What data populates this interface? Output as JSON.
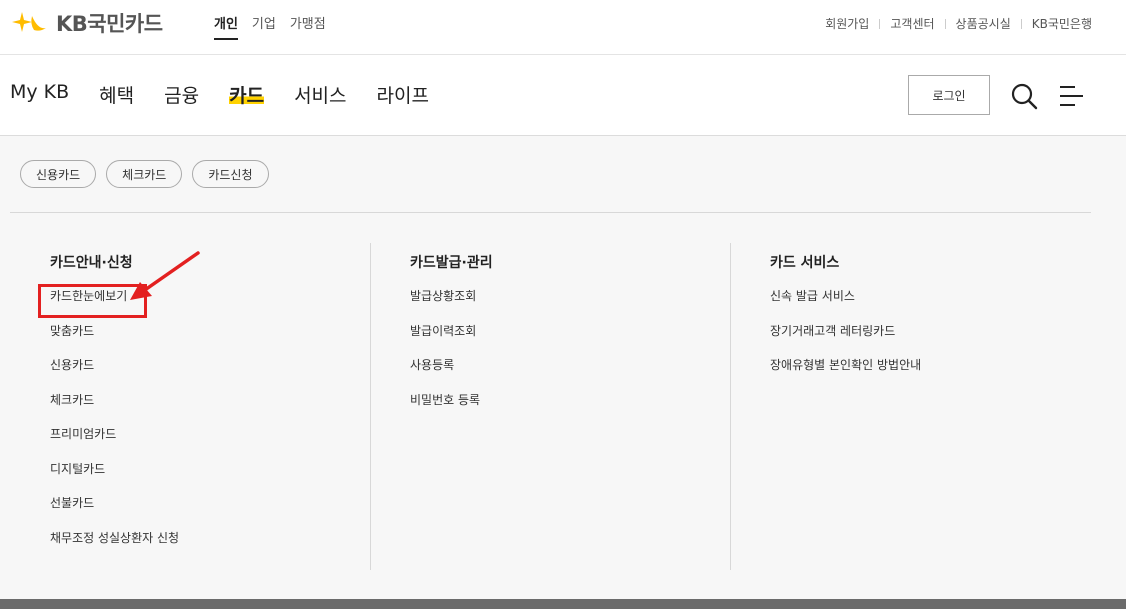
{
  "header": {
    "logo_text": "KB국민카드",
    "segment_tabs": [
      {
        "label": "개인",
        "active": true
      },
      {
        "label": "기업",
        "active": false
      },
      {
        "label": "가맹점",
        "active": false
      }
    ],
    "util_links": [
      "회원가입",
      "고객센터",
      "상품공시실",
      "KB국민은행"
    ]
  },
  "gnb": {
    "items": [
      {
        "label": "My KB",
        "active": false
      },
      {
        "label": "혜택",
        "active": false
      },
      {
        "label": "금융",
        "active": false
      },
      {
        "label": "카드",
        "active": true
      },
      {
        "label": "서비스",
        "active": false
      },
      {
        "label": "라이프",
        "active": false
      }
    ],
    "login_label": "로그인"
  },
  "chips": [
    "신용카드",
    "체크카드",
    "카드신청"
  ],
  "columns": [
    {
      "title": "카드안내·신청",
      "links": [
        "카드한눈에보기",
        "맞춤카드",
        "신용카드",
        "체크카드",
        "프리미엄카드",
        "디지털카드",
        "선불카드",
        "채무조정 성실상환자 신청"
      ]
    },
    {
      "title": "카드발급·관리",
      "links": [
        "발급상황조회",
        "발급이력조회",
        "사용등록",
        "비밀번호 등록"
      ]
    },
    {
      "title": "카드 서비스",
      "links": [
        "신속 발급 서비스",
        "장기거래고객 레터링카드",
        "장애유형별 본인확인 방법안내"
      ]
    }
  ],
  "colors": {
    "accent": "#ffd200",
    "annotation": "#e32020",
    "logo_star": "#ffbc00"
  },
  "icons": {
    "logo": "kb-star-logo-icon",
    "search": "search-icon",
    "menu": "hamburger-menu-icon",
    "arrow": "red-arrow-annotation"
  }
}
